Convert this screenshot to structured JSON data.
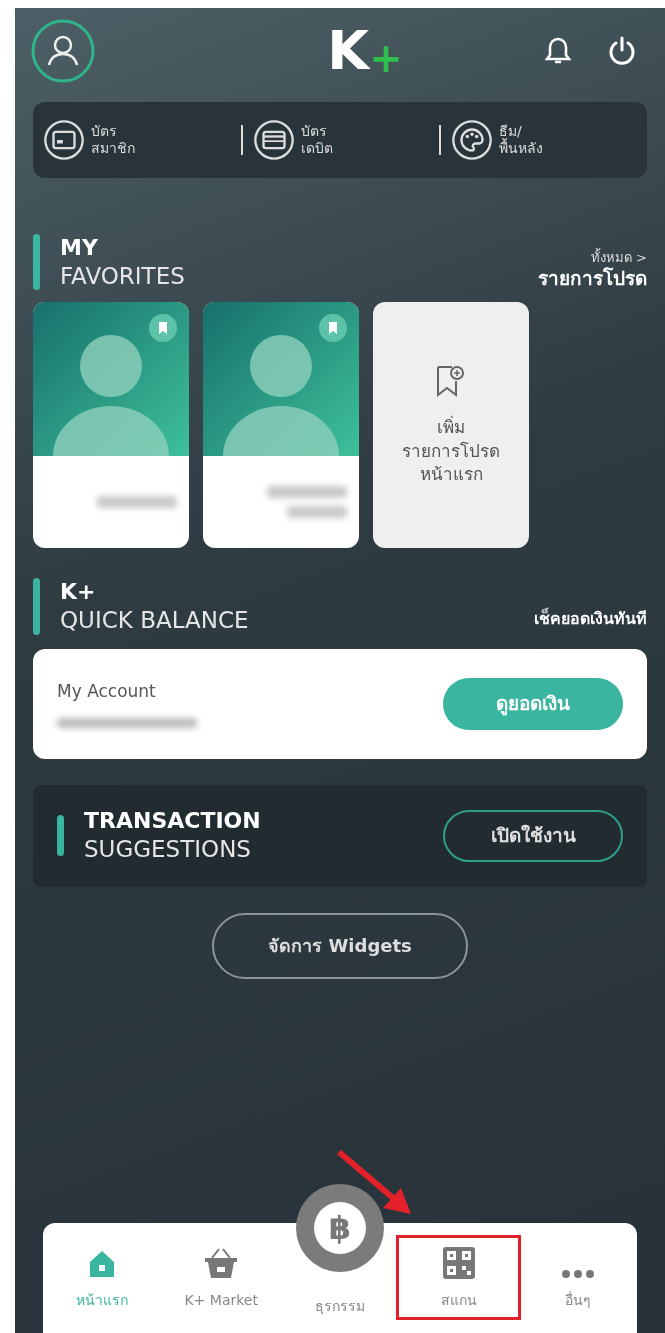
{
  "header": {
    "logo": {
      "letter": "K",
      "plus": "+"
    }
  },
  "shortcuts": [
    {
      "kind": "card",
      "line1": "บัตร",
      "line2": "สมาชิก"
    },
    {
      "kind": "debit",
      "line1": "บัตร",
      "line2": "เดบิต"
    },
    {
      "kind": "theme",
      "line1": "ธีม/",
      "line2": "พื้นหลัง"
    }
  ],
  "favorites": {
    "title_bold": "MY",
    "title": "FAVORITES",
    "link_top": "ทั้งหมด >",
    "link_bottom": "รายการโปรด",
    "add_card": {
      "lines": [
        "เพิ่ม",
        "รายการโปรด",
        "หน้าแรก"
      ]
    },
    "contacts": [
      {
        "bookmarked": true
      },
      {
        "bookmarked": true
      }
    ]
  },
  "quick_balance": {
    "title_bold": "K+",
    "title": "QUICK BALANCE",
    "link": "เช็คยอดเงินทันที",
    "account_label": "My Account",
    "button": "ดูยอดเงิน"
  },
  "transaction": {
    "title_bold": "TRANSACTION",
    "title": "SUGGESTIONS",
    "button": "เปิดใช้งาน"
  },
  "manage_button": "จัดการ Widgets",
  "bottom_nav": [
    {
      "kind": "home",
      "label": "หน้าแรก",
      "selected": true,
      "highlighted": false
    },
    {
      "kind": "market",
      "label": "K+ Market",
      "selected": false,
      "highlighted": false
    },
    {
      "kind": "center",
      "symbol": "฿",
      "label": "ธุรกรรม",
      "selected": false,
      "highlighted": false
    },
    {
      "kind": "scan",
      "label": "สแกน",
      "selected": false,
      "highlighted": true
    },
    {
      "kind": "more",
      "label": "อื่นๆ",
      "selected": false,
      "highlighted": false
    }
  ]
}
